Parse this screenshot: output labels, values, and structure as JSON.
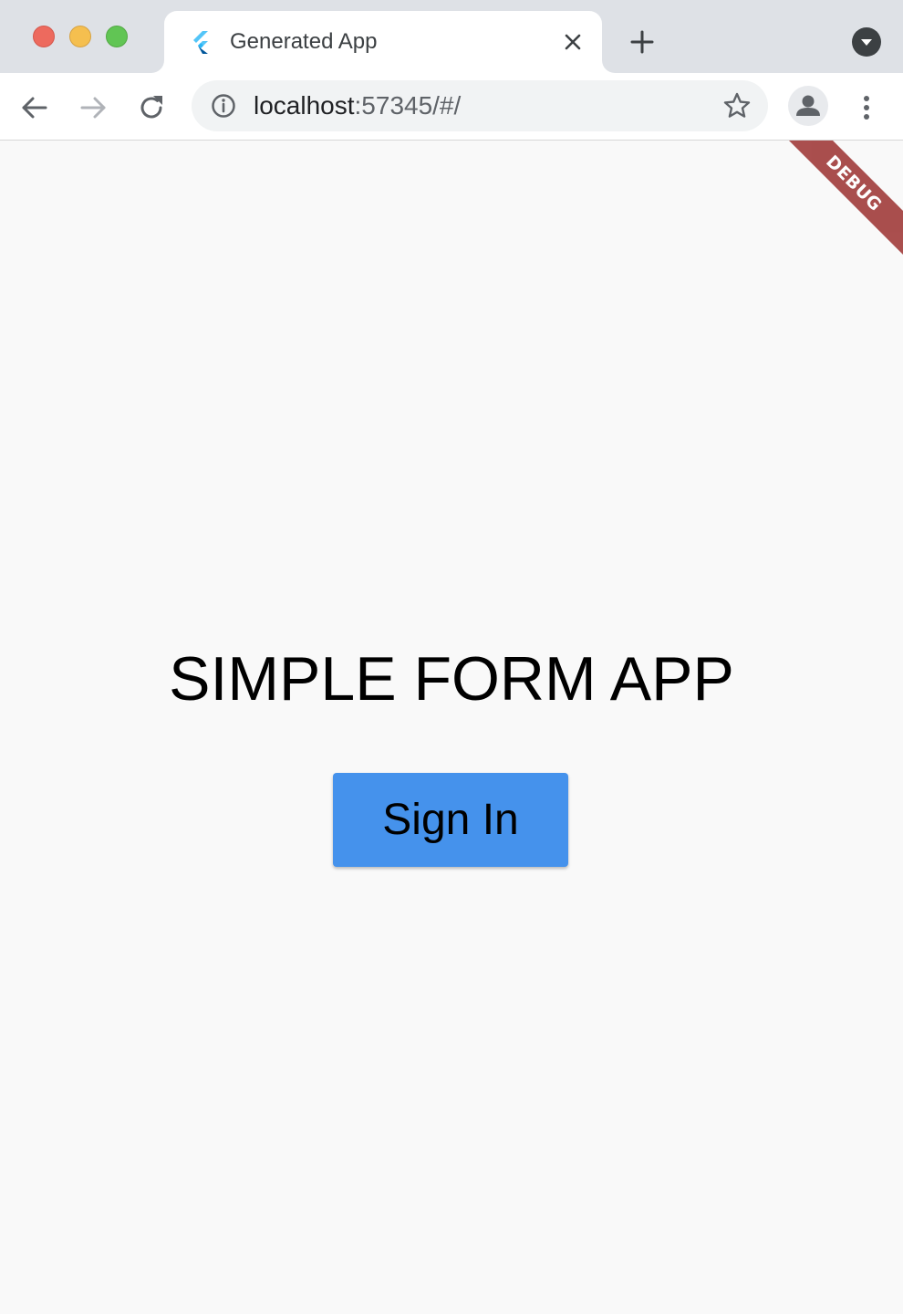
{
  "tab": {
    "title": "Generated App",
    "favicon": "flutter-logo-icon"
  },
  "toolbar": {
    "url_host": "localhost",
    "url_rest": ":57345/#/"
  },
  "app": {
    "title": "SIMPLE FORM APP",
    "signin_label": "Sign In",
    "debug_banner": "DEBUG"
  },
  "colors": {
    "tabstrip": "#dee1e6",
    "button": "#4592ec",
    "debug_banner": "#a3403f",
    "page_background": "#f9f9f9"
  }
}
